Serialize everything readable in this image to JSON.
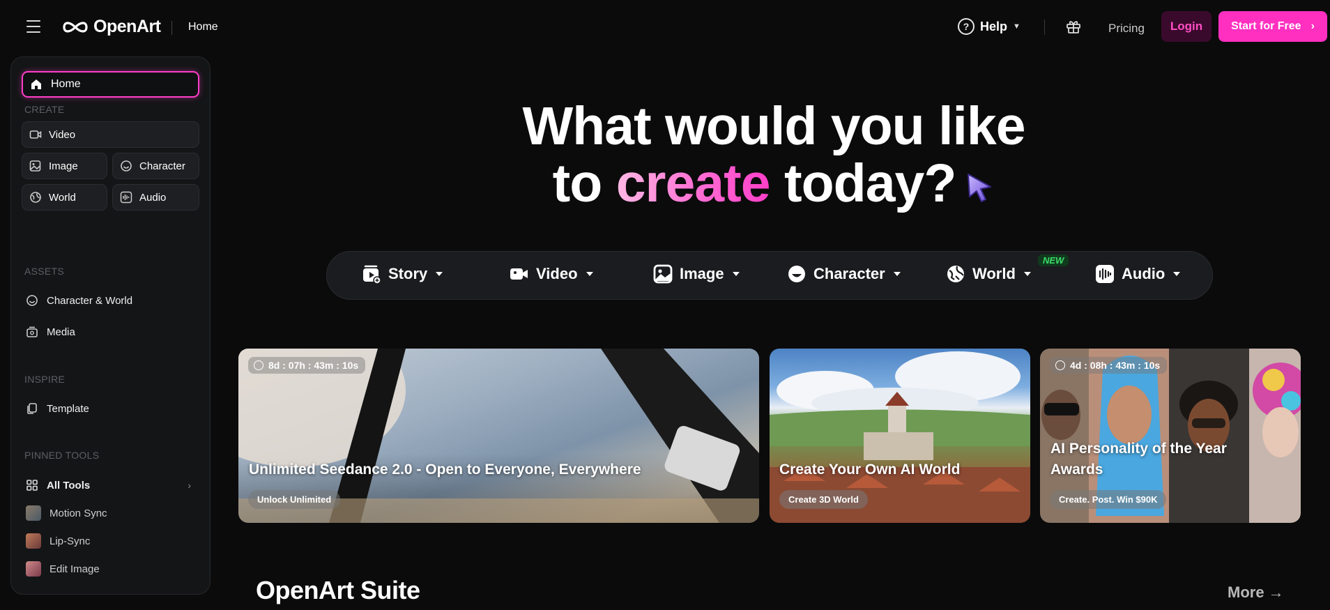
{
  "header": {
    "logo_text": "OpenArt",
    "breadcrumb": "Home",
    "help_label": "Help",
    "pricing_label": "Pricing",
    "login_label": "Login",
    "start_label": "Start for Free"
  },
  "sidebar": {
    "home_label": "Home",
    "create_label": "CREATE",
    "create_items": {
      "video": "Video",
      "image": "Image",
      "character": "Character",
      "world": "World",
      "audio": "Audio"
    },
    "assets_label": "ASSETS",
    "assets_items": {
      "character_world": "Character & World",
      "media": "Media"
    },
    "inspire_label": "INSPIRE",
    "inspire_items": {
      "template": "Template"
    },
    "pinned_label": "PINNED TOOLS",
    "pinned_items": {
      "all_tools": "All Tools",
      "motion_sync": "Motion Sync",
      "lip_sync": "Lip-Sync",
      "edit_image": "Edit Image"
    }
  },
  "hero": {
    "line1": "What would you like",
    "line2_prefix": "to ",
    "line2_accent": "create",
    "line2_suffix": " today?"
  },
  "toolbar": {
    "story": "Story",
    "video": "Video",
    "image": "Image",
    "character": "Character",
    "world": "World",
    "world_badge": "NEW",
    "audio": "Audio"
  },
  "cards": [
    {
      "timer": "8d : 07h : 43m : 10s",
      "title": "Unlimited Seedance 2.0 - Open to Everyone, Everywhere",
      "cta": "Unlock Unlimited"
    },
    {
      "title": "Create Your Own AI World",
      "cta": "Create 3D World"
    },
    {
      "timer": "4d : 08h : 43m : 10s",
      "title_line1": "AI Personality of the Year",
      "title_line2": "Awards",
      "cta": "Create. Post. Win $90K"
    }
  ],
  "suite": {
    "title": "OpenArt Suite",
    "more_label": "More →"
  },
  "colors": {
    "accent_pink": "#ff2fc0",
    "badge_green": "#3ddc6a",
    "background": "#0b0b0c",
    "sidebar_bg": "#141517"
  }
}
